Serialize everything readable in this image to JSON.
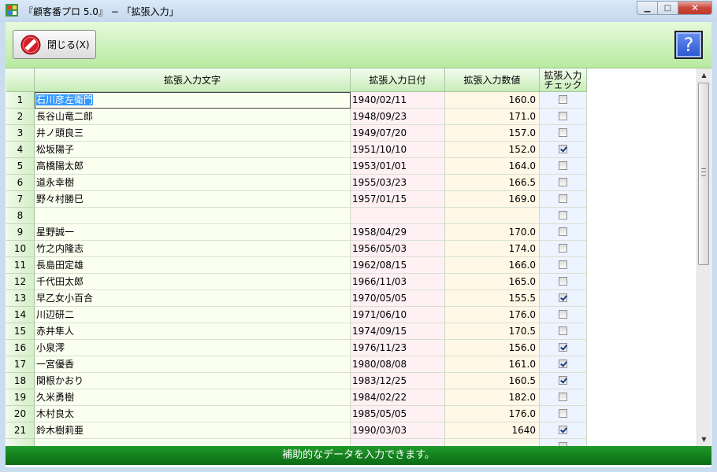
{
  "window": {
    "title": "『顧客番プロ 5.0』 − 「拡張入力」",
    "minimize_glyph": "▁",
    "maximize_glyph": "□",
    "close_glyph": "✕"
  },
  "toolbar": {
    "close_label": "閉じる(X)",
    "help_label": "?"
  },
  "table": {
    "headers": {
      "text": "拡張入力文字",
      "date": "拡張入力日付",
      "number": "拡張入力数値",
      "check": "拡張入力\nチェック"
    },
    "rows": [
      {
        "no": "1",
        "text": "石川彦左衛門",
        "date": "1940/02/11",
        "number": "160.0",
        "checked": false
      },
      {
        "no": "2",
        "text": "長谷山竜二郎",
        "date": "1948/09/23",
        "number": "171.0",
        "checked": false
      },
      {
        "no": "3",
        "text": "井ノ頭良三",
        "date": "1949/07/20",
        "number": "157.0",
        "checked": false
      },
      {
        "no": "4",
        "text": "松坂陽子",
        "date": "1951/10/10",
        "number": "152.0",
        "checked": true
      },
      {
        "no": "5",
        "text": "高橋陽太郎",
        "date": "1953/01/01",
        "number": "164.0",
        "checked": false
      },
      {
        "no": "6",
        "text": "道永幸樹",
        "date": "1955/03/23",
        "number": "166.5",
        "checked": false
      },
      {
        "no": "7",
        "text": "野々村勝巳",
        "date": "1957/01/15",
        "number": "169.0",
        "checked": false
      },
      {
        "no": "8",
        "text": "",
        "date": "",
        "number": "",
        "checked": false
      },
      {
        "no": "9",
        "text": "星野誠一",
        "date": "1958/04/29",
        "number": "170.0",
        "checked": false
      },
      {
        "no": "10",
        "text": "竹之内隆志",
        "date": "1956/05/03",
        "number": "174.0",
        "checked": false
      },
      {
        "no": "11",
        "text": "長島田定雄",
        "date": "1962/08/15",
        "number": "166.0",
        "checked": false
      },
      {
        "no": "12",
        "text": "千代田太郎",
        "date": "1966/11/03",
        "number": "165.0",
        "checked": false
      },
      {
        "no": "13",
        "text": "早乙女小百合",
        "date": "1970/05/05",
        "number": "155.5",
        "checked": true
      },
      {
        "no": "14",
        "text": "川辺研二",
        "date": "1971/06/10",
        "number": "176.0",
        "checked": false
      },
      {
        "no": "15",
        "text": "赤井隼人",
        "date": "1974/09/15",
        "number": "170.5",
        "checked": false
      },
      {
        "no": "16",
        "text": "小泉澪",
        "date": "1976/11/23",
        "number": "156.0",
        "checked": true
      },
      {
        "no": "17",
        "text": "一宮優香",
        "date": "1980/08/08",
        "number": "161.0",
        "checked": true
      },
      {
        "no": "18",
        "text": "関根かおり",
        "date": "1983/12/25",
        "number": "160.5",
        "checked": true
      },
      {
        "no": "19",
        "text": "久米勇樹",
        "date": "1984/02/22",
        "number": "182.0",
        "checked": false
      },
      {
        "no": "20",
        "text": "木村良太",
        "date": "1985/05/05",
        "number": "176.0",
        "checked": false
      },
      {
        "no": "21",
        "text": "鈴木樹莉亜",
        "date": "1990/03/03",
        "number": "1640",
        "checked": true
      }
    ]
  },
  "status_bar": {
    "text": "補助的なデータを入力できます。"
  },
  "colors": {
    "toolbar_bg": "#c8efb4",
    "status_bg": "#157a1e",
    "close_button_red": "#d21f2a",
    "help_button_blue": "#3a62d8"
  }
}
